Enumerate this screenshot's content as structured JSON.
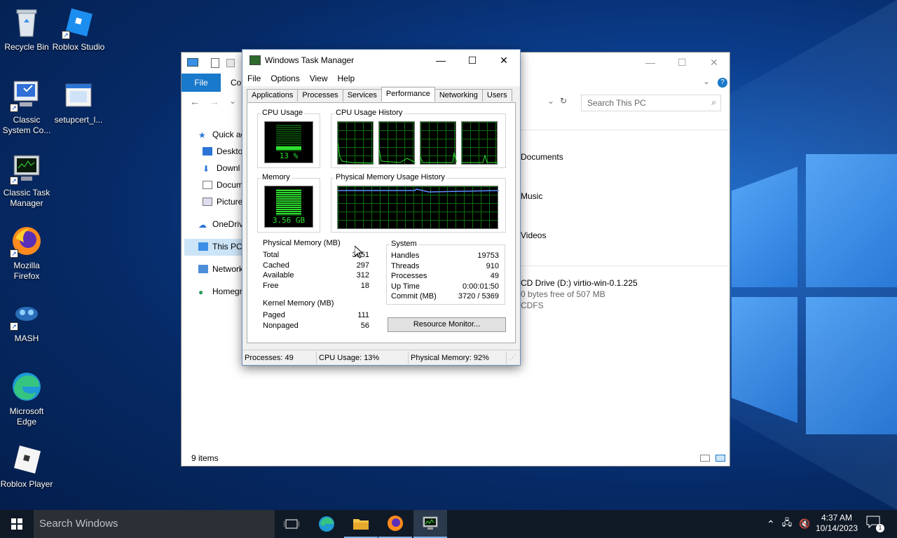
{
  "desktop": {
    "icons": [
      {
        "label": "Recycle Bin"
      },
      {
        "label": "Roblox Studio"
      },
      {
        "label": "Classic System Co..."
      },
      {
        "label": "setupcert_l..."
      },
      {
        "label": "Classic Task Manager"
      },
      {
        "label": "Mozilla Firefox"
      },
      {
        "label": "MASH"
      },
      {
        "label": "Microsoft Edge"
      },
      {
        "label": "Roblox Player"
      }
    ]
  },
  "explorer": {
    "file_tab": "File",
    "ribbon_tab_partial": "Co",
    "search_placeholder": "Search This PC",
    "nav": [
      {
        "label": "Quick ac"
      },
      {
        "label": "Deskto"
      },
      {
        "label": "Downl"
      },
      {
        "label": "Docum"
      },
      {
        "label": "Picture"
      },
      {
        "label": "OneDriv"
      },
      {
        "label": "This PC"
      },
      {
        "label": "Network"
      },
      {
        "label": "Homegr"
      }
    ],
    "content": [
      {
        "label": "Documents"
      },
      {
        "label": "Music"
      },
      {
        "label": "Videos"
      }
    ],
    "drive": {
      "name": "CD Drive (D:) virtio-win-0.1.225",
      "space": "0 bytes free of 507 MB",
      "fs": "CDFS"
    },
    "status": "9 items"
  },
  "taskmgr": {
    "title": "Windows Task Manager",
    "menu": [
      "File",
      "Options",
      "View",
      "Help"
    ],
    "tabs": [
      "Applications",
      "Processes",
      "Services",
      "Performance",
      "Networking",
      "Users"
    ],
    "active_tab": "Performance",
    "cpu_usage": {
      "label": "CPU Usage",
      "value": "13 %",
      "percent": 13
    },
    "cpu_history_label": "CPU Usage History",
    "memory": {
      "label": "Memory",
      "value": "3.56 GB",
      "percent": 92
    },
    "phys_history_label": "Physical Memory Usage History",
    "physical_memory": {
      "label": "Physical Memory (MB)",
      "rows": [
        {
          "k": "Total",
          "v": "3851"
        },
        {
          "k": "Cached",
          "v": "297"
        },
        {
          "k": "Available",
          "v": "312"
        },
        {
          "k": "Free",
          "v": "18"
        }
      ]
    },
    "kernel_memory": {
      "label": "Kernel Memory (MB)",
      "rows": [
        {
          "k": "Paged",
          "v": "111"
        },
        {
          "k": "Nonpaged",
          "v": "56"
        }
      ]
    },
    "system": {
      "label": "System",
      "rows": [
        {
          "k": "Handles",
          "v": "19753"
        },
        {
          "k": "Threads",
          "v": "910"
        },
        {
          "k": "Processes",
          "v": "49"
        },
        {
          "k": "Up Time",
          "v": "0:00:01:50"
        },
        {
          "k": "Commit (MB)",
          "v": "3720 / 5369"
        }
      ]
    },
    "resource_monitor_button": "Resource Monitor...",
    "status": {
      "processes": "Processes: 49",
      "cpu": "CPU Usage: 13%",
      "memory": "Physical Memory: 92%"
    }
  },
  "taskbar": {
    "search_placeholder": "Search Windows",
    "time": "4:37 AM",
    "date": "10/14/2023",
    "notification_count": "1"
  }
}
